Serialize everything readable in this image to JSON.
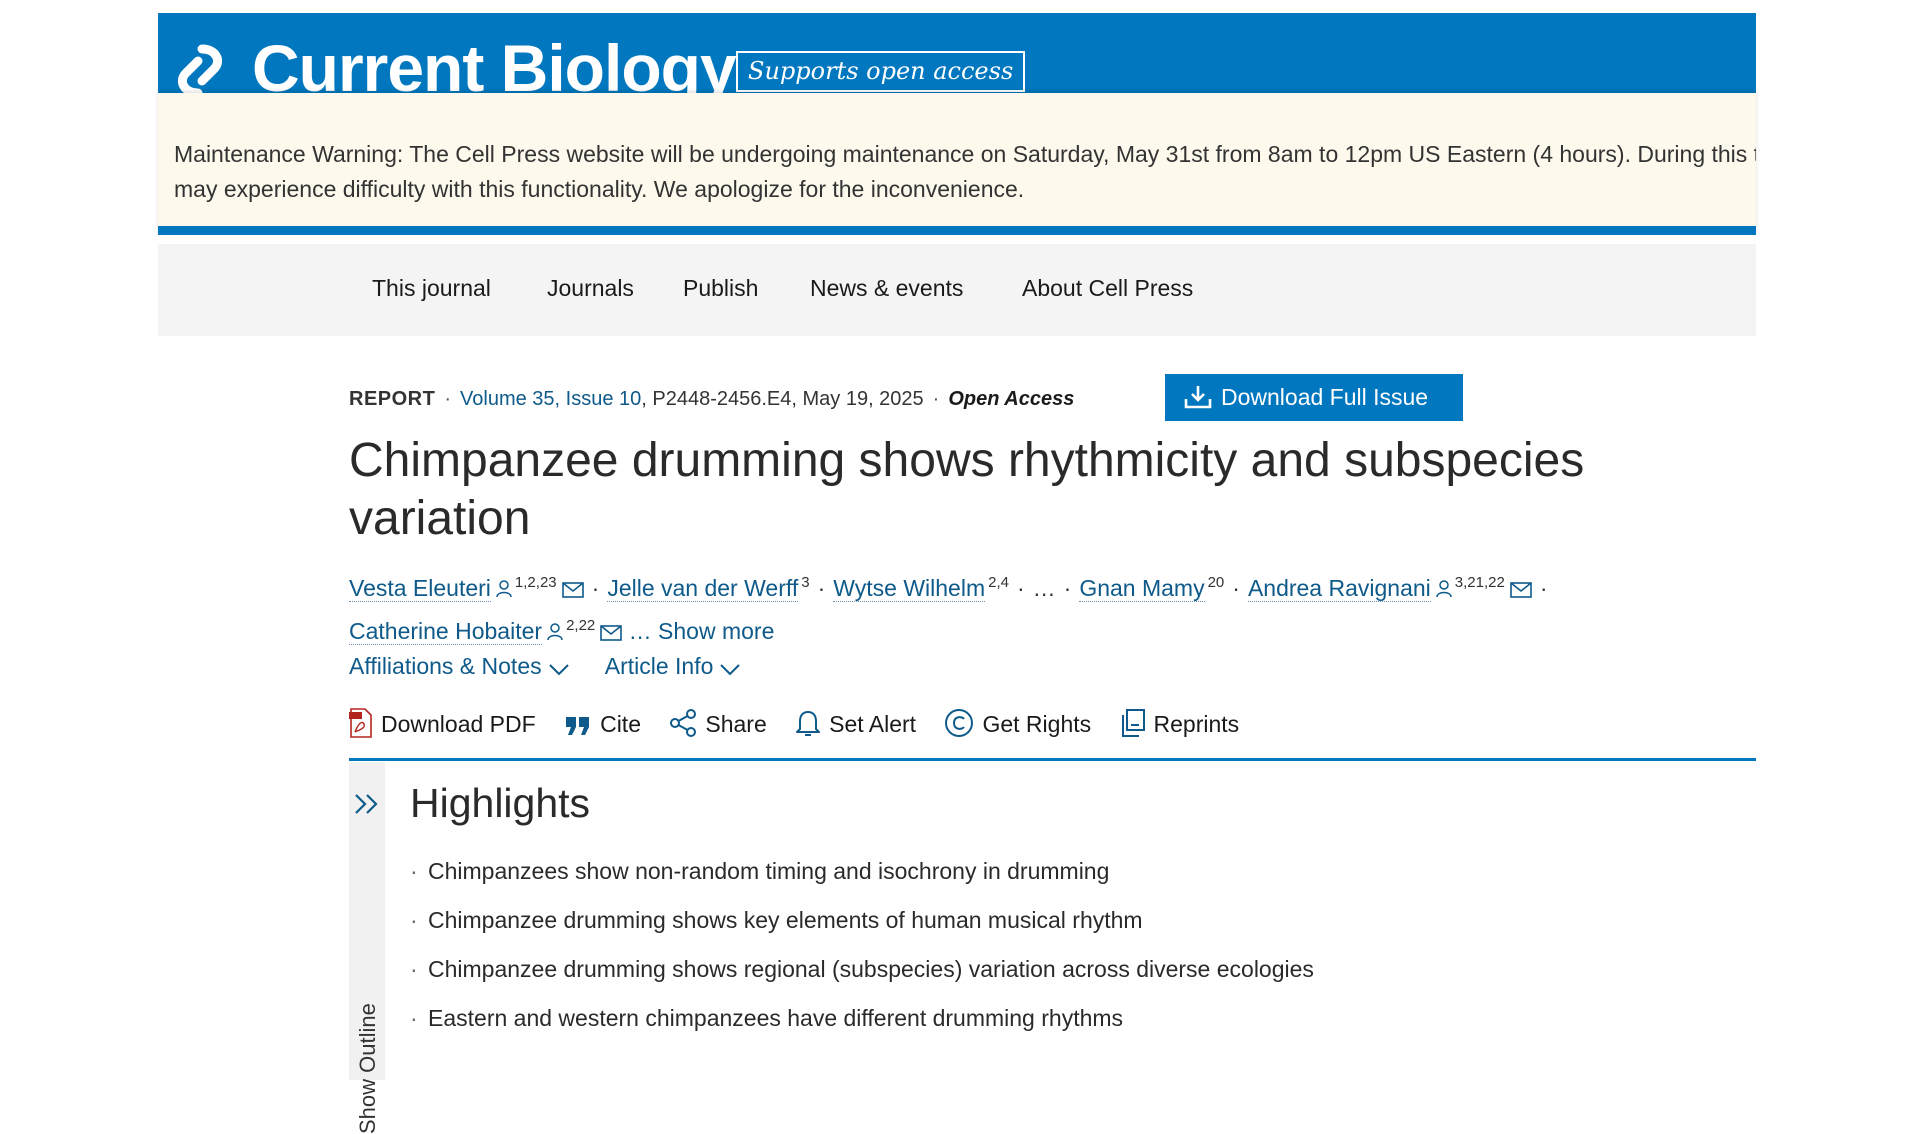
{
  "brand": {
    "logo_text": "Current Biology",
    "open_access_badge": "Supports open access",
    "color": "#0077be"
  },
  "maintenance": {
    "text": "Maintenance Warning: The Cell Press website will be undergoing maintenance on Saturday, May 31st from 8am to 12pm US Eastern (4 hours). During this time you may experience difficulty with this functionality. We apologize for the inconvenience."
  },
  "nav": {
    "items": [
      "This journal",
      "Journals",
      "Publish",
      "News & events",
      "About Cell Press"
    ]
  },
  "article": {
    "type": "REPORT",
    "volume_issue": "Volume 35, Issue 10",
    "pages_date": ", P2448-2456.E4, May 19, 2025",
    "open_access": "Open Access",
    "download_issue_label": "Download Full Issue",
    "title": "Chimpanzee drumming shows rhythmicity and subspecies variation"
  },
  "authors": {
    "list": [
      {
        "name": "Vesta Eleuteri",
        "sup": "1,2,23"
      },
      {
        "name": "Jelle van der Werff",
        "sup": "3"
      },
      {
        "name": "Wytse Wilhelm",
        "sup": "2,4"
      },
      {
        "name": "Gnan Mamy",
        "sup": "20"
      },
      {
        "name": "Andrea Ravignani",
        "sup": "3,21,22"
      },
      {
        "name": "Catherine Hobaiter",
        "sup": "2,22"
      }
    ],
    "ellipsis": "…",
    "show_more": "… Show more"
  },
  "disclosures": {
    "affiliations": "Affiliations & Notes",
    "article_info": "Article Info"
  },
  "tools": {
    "download_pdf": "Download PDF",
    "cite": "Cite",
    "share": "Share",
    "set_alert": "Set Alert",
    "get_rights": "Get Rights",
    "reprints": "Reprints"
  },
  "outline": {
    "label": "Show Outline"
  },
  "highlights": {
    "heading": "Highlights",
    "items": [
      "Chimpanzees show non-random timing and isochrony in drumming",
      "Chimpanzee drumming shows key elements of human musical rhythm",
      "Chimpanzee drumming shows regional (subspecies) variation across diverse ecologies",
      "Eastern and western chimpanzees have different drumming rhythms"
    ]
  }
}
